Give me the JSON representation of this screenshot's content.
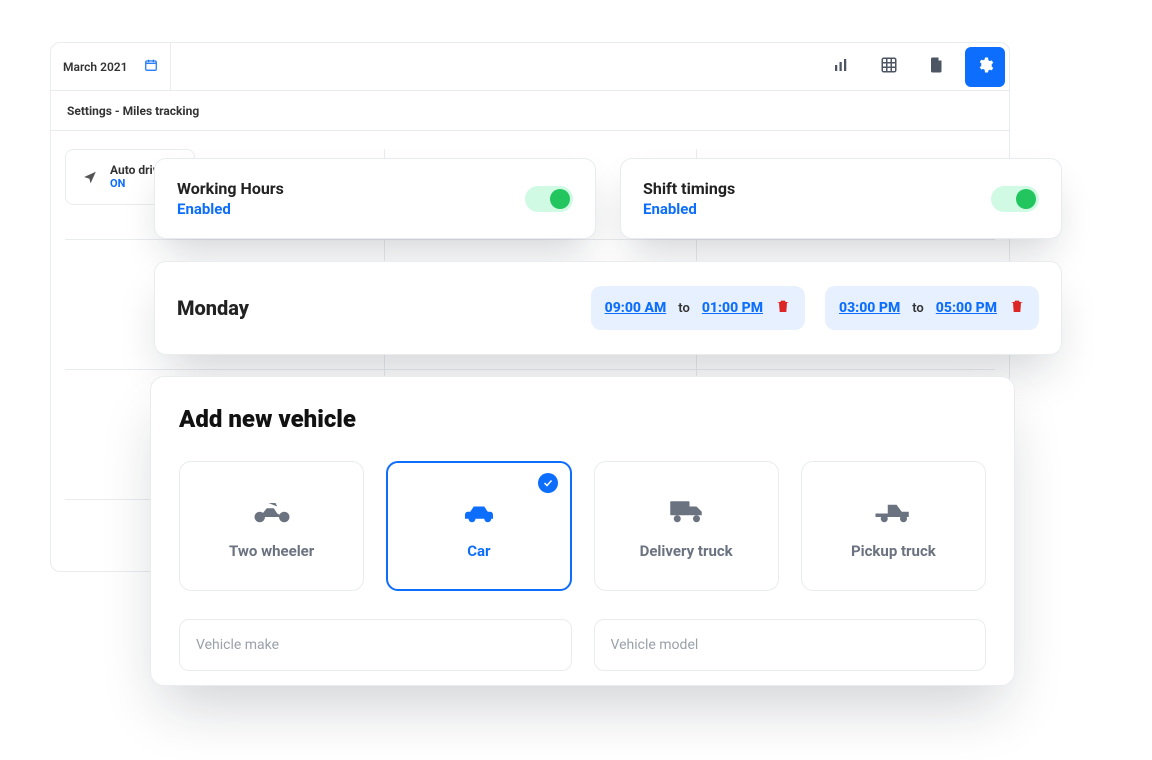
{
  "header": {
    "date_label": "March 2021",
    "active_action": "settings"
  },
  "subheader": {
    "breadcrumb": "Settings - Miles tracking"
  },
  "auto_drive": {
    "title": "Auto drive",
    "status": "ON"
  },
  "settings": {
    "working_hours": {
      "title": "Working Hours",
      "status": "Enabled",
      "enabled": true
    },
    "shift_timings": {
      "title": "Shift timings",
      "status": "Enabled",
      "enabled": true
    }
  },
  "schedule": {
    "day": "Monday",
    "slots": [
      {
        "start": "09:00 AM",
        "to": "to",
        "end": "01:00 PM"
      },
      {
        "start": "03:00 PM",
        "to": "to",
        "end": "05:00 PM"
      }
    ]
  },
  "vehicle": {
    "heading": "Add new vehicle",
    "selected": "car",
    "types": [
      {
        "key": "two_wheeler",
        "label": "Two wheeler"
      },
      {
        "key": "car",
        "label": "Car"
      },
      {
        "key": "delivery",
        "label": "Delivery truck"
      },
      {
        "key": "pickup",
        "label": "Pickup truck"
      }
    ],
    "fields": {
      "make_placeholder": "Vehicle make",
      "model_placeholder": "Vehicle model"
    }
  },
  "colors": {
    "primary": "#0d6efd",
    "green": "#22c55e",
    "light_blue": "#e7f0ff"
  }
}
